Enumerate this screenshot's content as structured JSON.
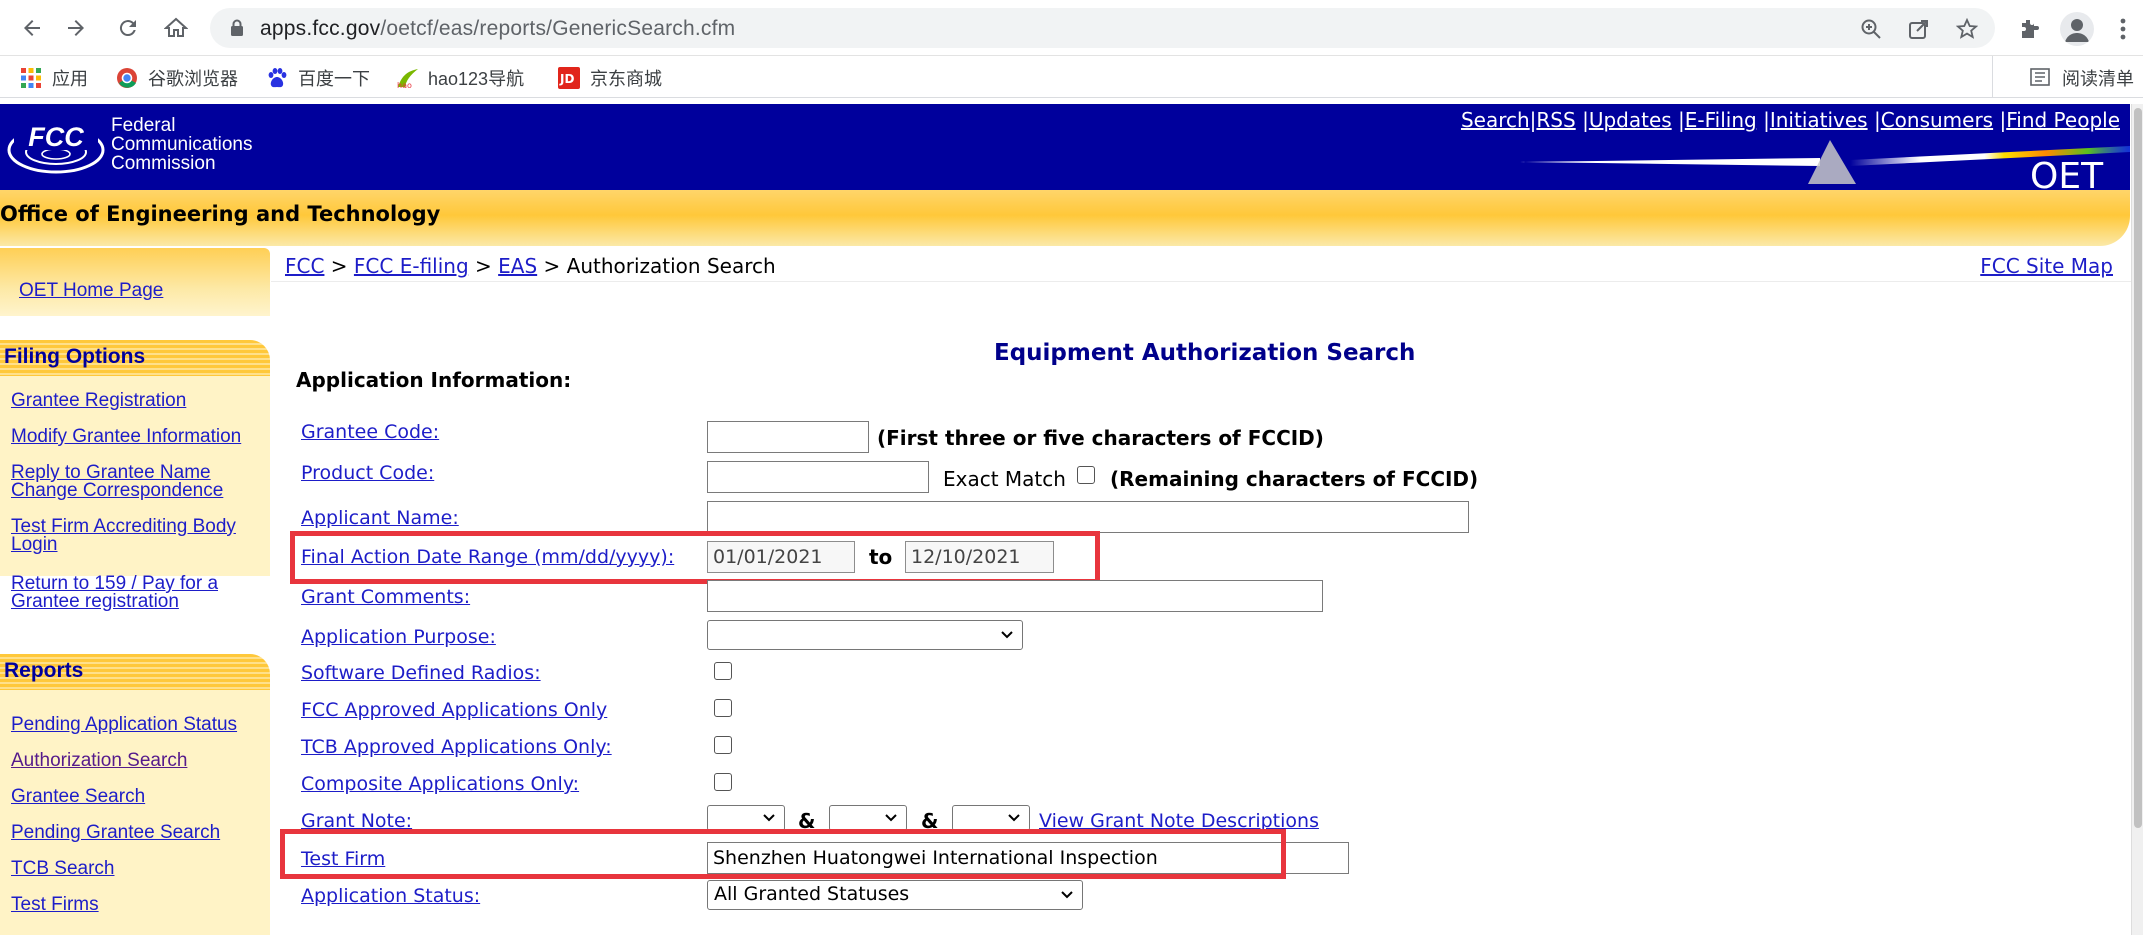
{
  "browser": {
    "url_host": "apps.fcc.gov",
    "url_path": "/oetcf/eas/reports/GenericSearch.cfm",
    "bookmarks": [
      {
        "label": "应用",
        "icon": "apps-grid-icon"
      },
      {
        "label": "谷歌浏览器",
        "icon": "chrome-icon"
      },
      {
        "label": "百度一下",
        "icon": "baidu-paw-icon"
      },
      {
        "label": "hao123导航",
        "icon": "hao123-icon"
      },
      {
        "label": "京东商城",
        "icon": "jd-icon"
      }
    ],
    "reading_list": "阅读清单"
  },
  "header": {
    "logo_text": "FCC",
    "wordmark": [
      "Federal",
      "Communications",
      "Commission"
    ],
    "top_links": [
      "Search",
      "RSS",
      "Updates",
      "E-Filing",
      "Initiatives",
      "Consumers",
      "Find People"
    ],
    "oet_mark": "OET",
    "office_title": "Office of Engineering and Technology"
  },
  "sidebar": {
    "home_link": "OET Home Page",
    "filing_options": {
      "title": "Filing Options",
      "items": [
        "Grantee Registration",
        "Modify Grantee Information",
        "Reply to Grantee Name Change Correspondence",
        "Test Firm Accrediting Body Login",
        "Return to 159 / Pay for a Grantee registration"
      ]
    },
    "reports": {
      "title": "Reports",
      "items": [
        "Pending Application Status",
        "Authorization Search",
        "Grantee Search",
        "Pending Grantee Search",
        "TCB Search",
        "Test Firms"
      ]
    }
  },
  "breadcrumb": {
    "items": [
      "FCC",
      "FCC E-filing",
      "EAS"
    ],
    "separator": ">",
    "current": "Authorization Search",
    "site_map": "FCC Site Map"
  },
  "form": {
    "title": "Equipment Authorization Search",
    "section": "Application Information:",
    "grantee_code": {
      "label": "Grantee Code:",
      "value": "",
      "note": "(First three or five characters of FCCID)"
    },
    "product_code": {
      "label": "Product Code:",
      "value": "",
      "exact_match": "Exact Match",
      "note": "(Remaining characters of FCCID)"
    },
    "applicant_name": {
      "label": "Applicant Name:",
      "value": ""
    },
    "date_range": {
      "label": "Final Action Date Range (mm/dd/yyyy):",
      "from": "01/01/2021",
      "to_label": "to",
      "to": "12/10/2021"
    },
    "grant_comments": {
      "label": "Grant Comments:",
      "value": ""
    },
    "application_purpose": {
      "label": "Application Purpose:",
      "value": ""
    },
    "checkboxes": [
      {
        "label": "Software Defined Radios:",
        "checked": false
      },
      {
        "label": "FCC Approved Applications Only",
        "checked": false
      },
      {
        "label": "TCB Approved Applications Only:",
        "checked": false
      },
      {
        "label": "Composite Applications Only:",
        "checked": false
      }
    ],
    "grant_note": {
      "label": "Grant Note:",
      "amp": "&",
      "link": "View Grant Note Descriptions"
    },
    "test_firm": {
      "label": "Test Firm",
      "value": "Shenzhen Huatongwei International Inspection"
    },
    "application_status": {
      "label": "Application Status:",
      "value": "All Granted Statuses"
    }
  },
  "colors": {
    "fcc_blue": "#00009c",
    "band_gold": "#ffc83a",
    "link": "#1d1dc8",
    "highlight": "#e8353d"
  }
}
